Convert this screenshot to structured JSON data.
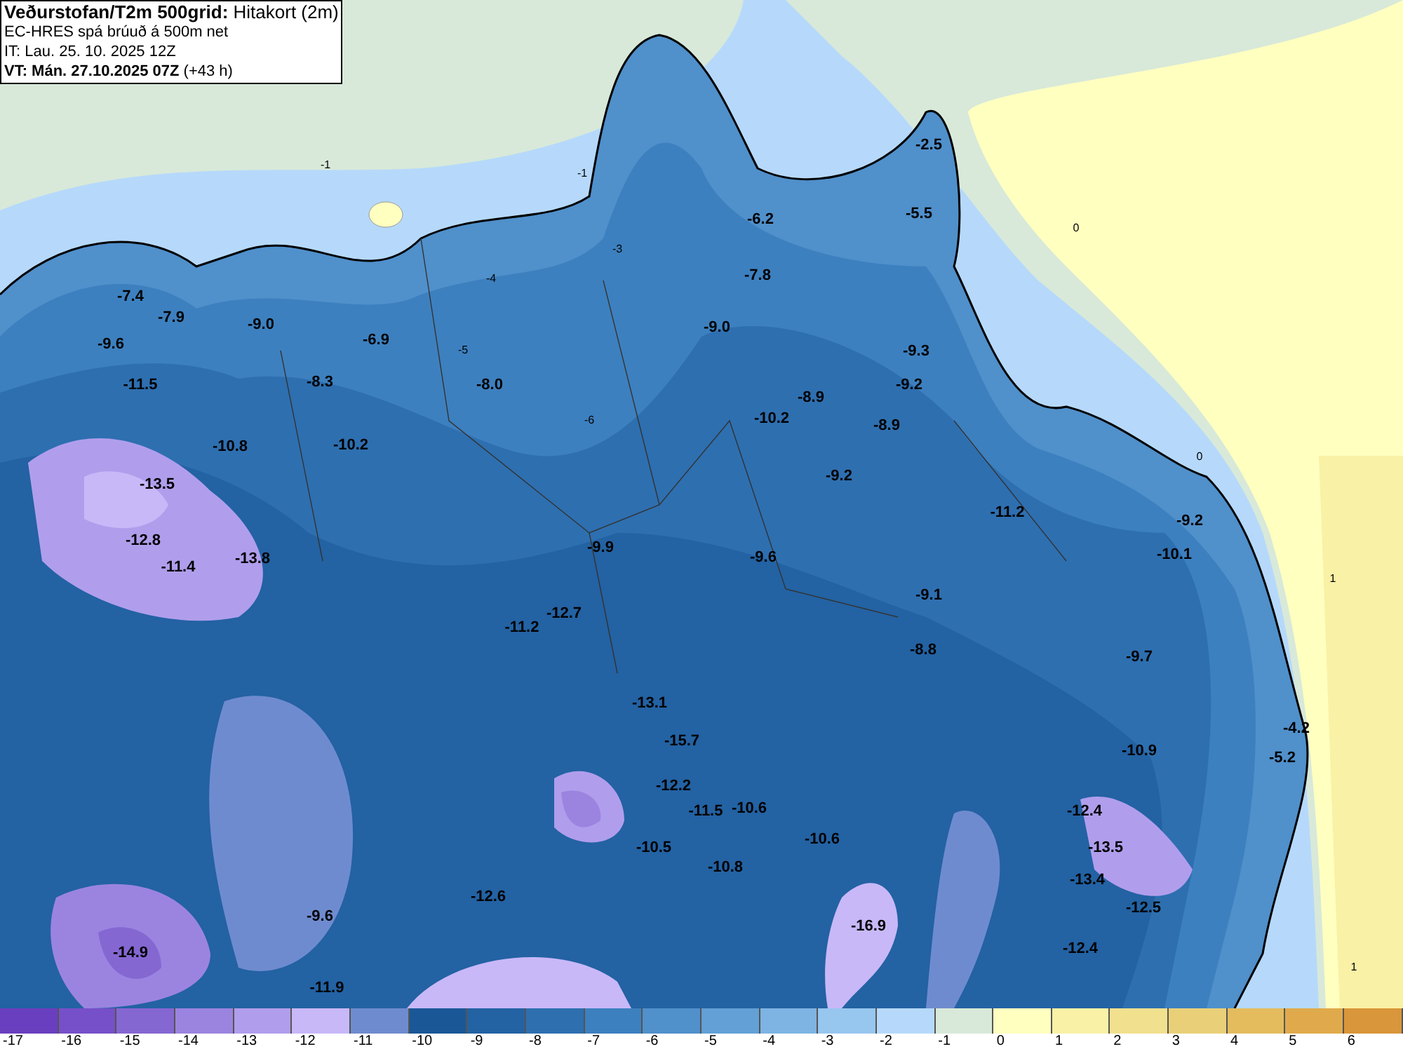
{
  "header": {
    "lines": [
      "**Veðurstofan/T2m 500grid:** Hitakort (2m)",
      "EC-HRES spá brúuð á 500m net",
      "IT: Lau. 25. 10. 2025 12Z",
      "**VT: Mán. 27.10.2025 07Z** (+43 h)"
    ]
  },
  "map": {
    "values": [
      "-2.5",
      "-5.5",
      "-6.2",
      "-7.8",
      "-7.4",
      "-7.9",
      "-9.0",
      "-6.9",
      "-9.6",
      "-9.0",
      "-9.3",
      "-11.5",
      "-8.3",
      "-8.0",
      "-9.2",
      "-8.9",
      "-10.2",
      "-8.9",
      "-10.8",
      "-10.2",
      "-13.5",
      "-9.2",
      "-11.2",
      "-9.2",
      "-12.8",
      "-9.9",
      "-10.1",
      "-11.4",
      "-13.8",
      "-9.6",
      "-9.1",
      "-11.2",
      "-12.7",
      "-8.8",
      "-9.7",
      "-13.1",
      "-15.7",
      "-4.2",
      "-10.9",
      "-5.2",
      "-12.2",
      "-11.5",
      "-10.6",
      "-12.4",
      "-10.6",
      "-13.5",
      "-10.5",
      "-10.8",
      "-13.4",
      "-12.6",
      "-12.5",
      "-9.6",
      "-16.9",
      "-14.9",
      "-12.4",
      "-11.9"
    ],
    "contour_labels": [
      "-1",
      "0",
      "-1",
      "0",
      "1",
      "1",
      "-3",
      "-4",
      "-5",
      "-6"
    ]
  },
  "colorbar": [
    {
      "label": "-17",
      "color": "#6a3fbf"
    },
    {
      "label": "-16",
      "color": "#7650c9"
    },
    {
      "label": "-15",
      "color": "#8567d2"
    },
    {
      "label": "-14",
      "color": "#9b84e0"
    },
    {
      "label": "-13",
      "color": "#b09eec"
    },
    {
      "label": "-12",
      "color": "#c8b8f8"
    },
    {
      "label": "-11",
      "color": "#6f8bcf"
    },
    {
      "label": "-10",
      "color": "#1a5797"
    },
    {
      "label": "-9",
      "color": "#2362a3"
    },
    {
      "label": "-8",
      "color": "#2e6fb0"
    },
    {
      "label": "-7",
      "color": "#3d80bf"
    },
    {
      "label": "-6",
      "color": "#5090cb"
    },
    {
      "label": "-5",
      "color": "#62a0d6"
    },
    {
      "label": "-4",
      "color": "#7eb4e3"
    },
    {
      "label": "-3",
      "color": "#97c6ef"
    },
    {
      "label": "-2",
      "color": "#b6d9fb"
    },
    {
      "label": "-1",
      "color": "#d8e9d9"
    },
    {
      "label": "0",
      "color": "#ffffc0"
    },
    {
      "label": "1",
      "color": "#f9f1a6"
    },
    {
      "label": "2",
      "color": "#f1e08e"
    },
    {
      "label": "3",
      "color": "#e9d078"
    },
    {
      "label": "4",
      "color": "#e4bc5e"
    },
    {
      "label": "5",
      "color": "#e0aa4c"
    },
    {
      "label": "6",
      "color": "#d9963a"
    }
  ]
}
